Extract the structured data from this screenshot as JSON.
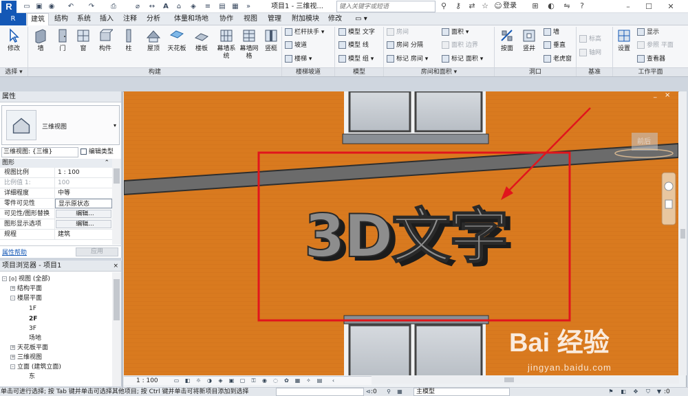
{
  "titlebar": {
    "app_logo": "R",
    "project_tab": "项目1 - 三维视...",
    "search_placeholder": "键入关键字或短语",
    "login": "登录",
    "help": "?",
    "icons": [
      "open-icon",
      "save-icon",
      "undo-icon",
      "redo-icon",
      "print-icon",
      "measure-icon",
      "text-icon",
      "3d-view-icon",
      "section-icon",
      "thin-lines-icon",
      "close-hidden-icon",
      "switch-window-icon",
      "binoculars-icon",
      "key-icon",
      "star-icon",
      "user-icon",
      "cart-icon",
      "exchange-icon",
      "help-icon"
    ]
  },
  "ribbon_tabs": {
    "file": "R",
    "tabs": [
      "建筑",
      "结构",
      "系统",
      "插入",
      "注释",
      "分析",
      "体量和场地",
      "协作",
      "视图",
      "管理",
      "附加模块",
      "修改"
    ],
    "active": "建筑"
  },
  "ribbon": {
    "modify": "修改",
    "select": "选择",
    "build_buttons": [
      "墙",
      "门",
      "窗",
      "构件",
      "柱",
      "屋顶",
      "天花板",
      "楼板",
      "幕墙系统",
      "幕墙网格",
      "竖梃"
    ],
    "build_title": "构建",
    "stair_items": [
      "栏杆扶手",
      "坡道",
      "楼梯"
    ],
    "stair_title": "楼梯坡道",
    "model_items": [
      "模型 文字",
      "模型 线",
      "模型 组"
    ],
    "model_title": "模型",
    "room_items": [
      "房间",
      "房间 分隔",
      "标记 房间",
      "面积",
      "面积 边界",
      "标记 面积"
    ],
    "room_title": "房间和面积",
    "opening_buttons": [
      "按面",
      "竖井"
    ],
    "opening_small": [
      "墙",
      "垂直",
      "老虎窗"
    ],
    "opening_title": "洞口",
    "datum_items": [
      "标高",
      "轴网"
    ],
    "datum_title": "基准",
    "work_buttons": [
      "设置"
    ],
    "work_small": [
      "显示",
      "参照 平面",
      "查看器"
    ],
    "work_title": "工作平面"
  },
  "properties": {
    "header": "属性",
    "type_name": "三维视图",
    "view_selector": "三维视图: {三维}",
    "edit_type": "编辑类型",
    "section": "图形",
    "rows": [
      {
        "name": "视图比例",
        "value": "1 : 100"
      },
      {
        "name": "比例值 1:",
        "value": "100"
      },
      {
        "name": "详细程度",
        "value": "中等"
      },
      {
        "name": "零件可见性",
        "value": "显示原状态"
      },
      {
        "name": "可见性/图形替换",
        "value": "编辑..."
      },
      {
        "name": "图形显示选项",
        "value": "编辑..."
      },
      {
        "name": "规程",
        "value": "建筑"
      }
    ],
    "help": "属性帮助",
    "apply": "应用"
  },
  "browser": {
    "header": "项目浏览器 - 项目1",
    "close": "×",
    "nodes": [
      "视图 (全部)",
      "结构平面",
      "楼层平面",
      "1F",
      "2F",
      "3F",
      "场地",
      "天花板平面",
      "三维视图",
      "立面 (建筑立面)",
      "东"
    ]
  },
  "viewport": {
    "text_3d": "3D文字",
    "viewcube_label": "前后",
    "min": "_",
    "close": "×"
  },
  "viewbar": {
    "scale": "1 : 100"
  },
  "statusbar": {
    "text": "单击可进行选择; 按 Tab 键并单击可选择其他项目; 按 Ctrl 键并单击可将新项目添加到选择",
    "count": ":0",
    "model": "主模型",
    "count2": ":0"
  },
  "watermark": {
    "logo": "Bai 经验",
    "url": "jingyan.baidu.com"
  },
  "colors": {
    "wall_orange": "#d97a1f",
    "brand_blue": "#1458b6",
    "highlight_red": "#e1151c"
  }
}
